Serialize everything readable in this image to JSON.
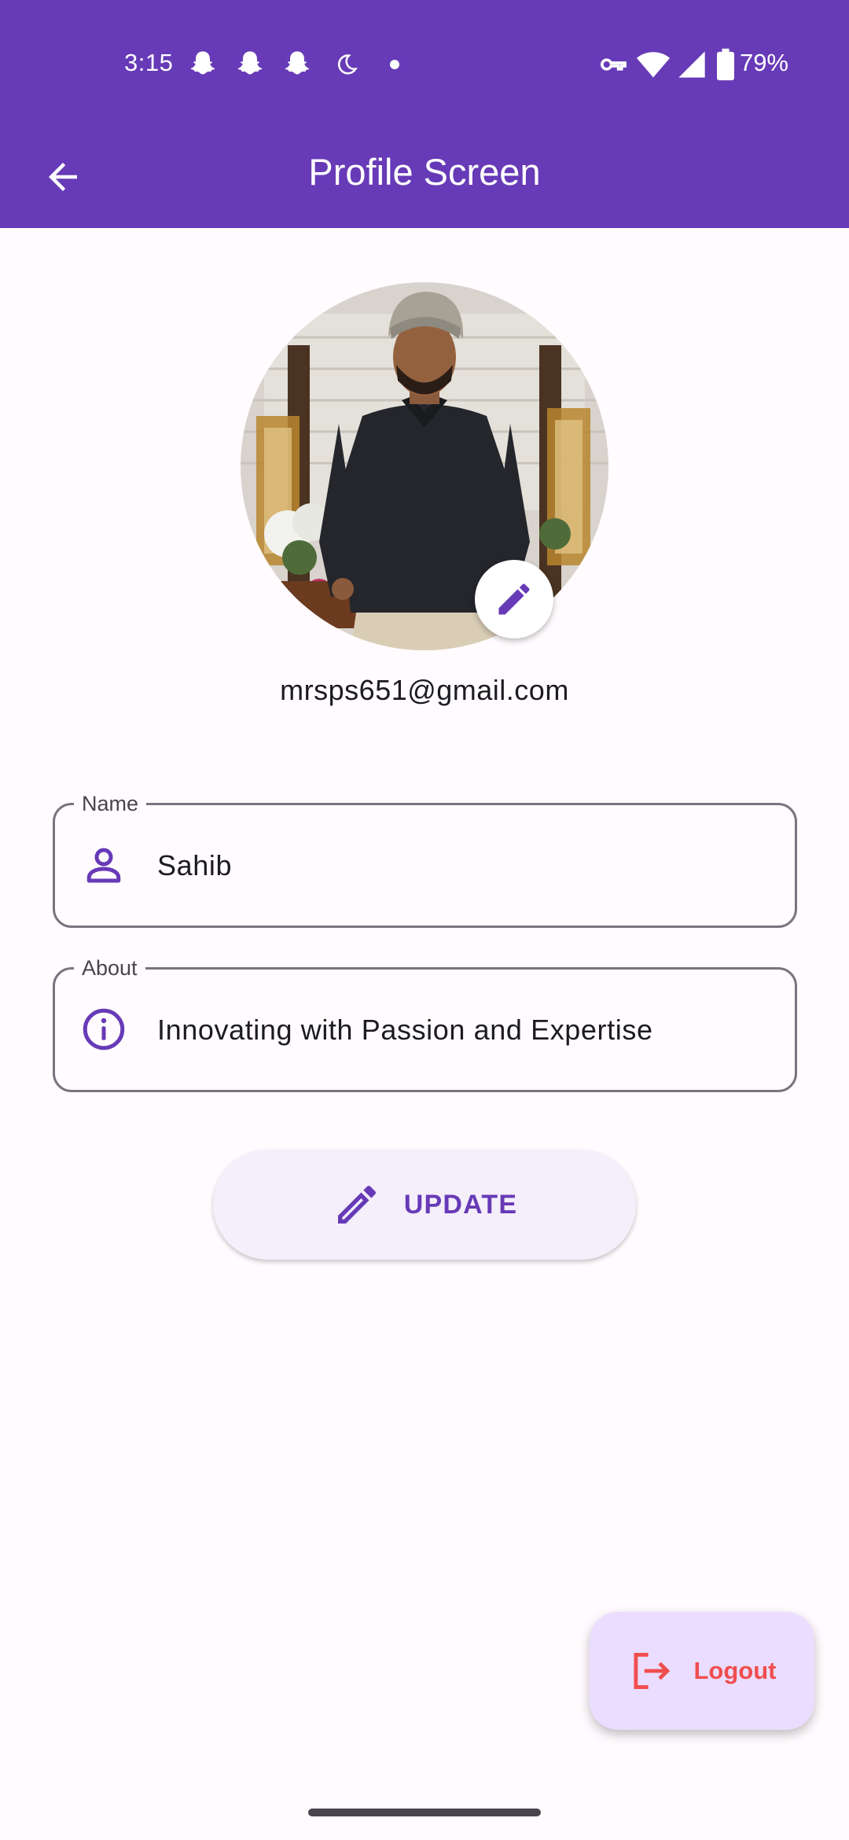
{
  "status_bar": {
    "time": "3:15",
    "battery_percent": "79%",
    "left_icons": [
      "snapchat-icon",
      "snapchat-icon",
      "snapchat-icon",
      "moon-icon",
      "dot-icon"
    ],
    "right_icons": [
      "vpn-key-icon",
      "wifi-icon",
      "cell-signal-icon",
      "battery-icon"
    ]
  },
  "app_bar": {
    "title": "Profile Screen",
    "back_icon": "arrow-back-icon"
  },
  "profile": {
    "email": "mrsps651@gmail.com",
    "avatar_icon": "profile-photo",
    "edit_icon": "pencil-icon"
  },
  "form": {
    "name": {
      "label": "Name",
      "value": "Sahib",
      "icon": "person-icon"
    },
    "about": {
      "label": "About",
      "value": "Innovating with Passion and Expertise",
      "icon": "info-icon"
    }
  },
  "actions": {
    "update_label": "UPDATE",
    "update_icon": "pencil-icon",
    "logout_label": "Logout",
    "logout_icon": "logout-icon"
  },
  "colors": {
    "primary": "#673ab7",
    "surface": "#fffbfe",
    "button_container": "#f4effa",
    "fab_container": "#eaddff",
    "logout_text": "#f04e4e"
  }
}
